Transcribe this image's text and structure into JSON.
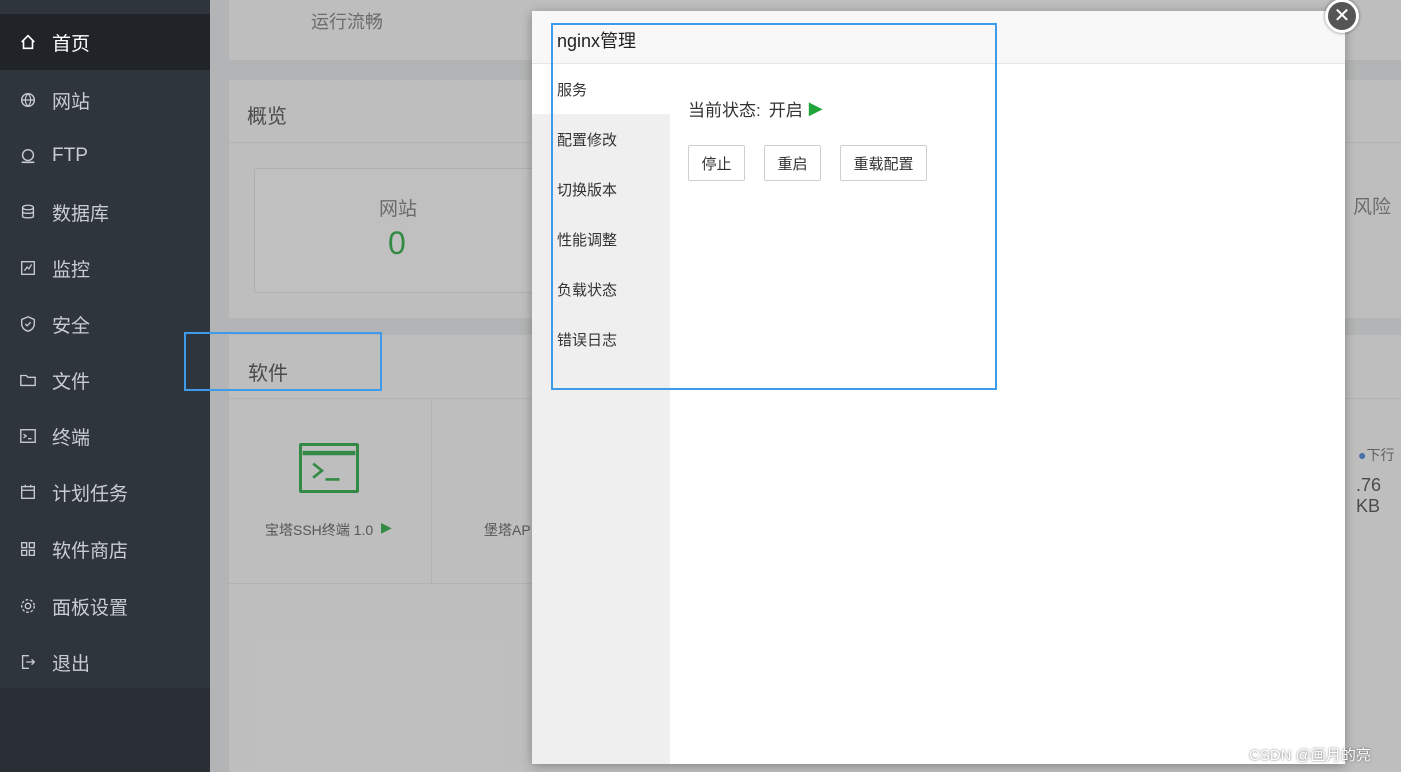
{
  "sidebar": {
    "items": [
      {
        "label": "首页",
        "icon": "home-icon",
        "active": true
      },
      {
        "label": "网站",
        "icon": "globe-icon"
      },
      {
        "label": "FTP",
        "icon": "ftp-icon"
      },
      {
        "label": "数据库",
        "icon": "database-icon"
      },
      {
        "label": "监控",
        "icon": "monitor-icon"
      },
      {
        "label": "安全",
        "icon": "shield-icon"
      },
      {
        "label": "文件",
        "icon": "folder-icon"
      },
      {
        "label": "终端",
        "icon": "terminal-icon"
      },
      {
        "label": "计划任务",
        "icon": "calendar-icon"
      },
      {
        "label": "软件商店",
        "icon": "apps-icon"
      },
      {
        "label": "面板设置",
        "icon": "gear-icon"
      },
      {
        "label": "退出",
        "icon": "logout-icon"
      }
    ]
  },
  "background": {
    "top_status": "运行流畅",
    "overview_title": "概览",
    "site_label": "网站",
    "site_count": "0",
    "risk_label": "风险",
    "software_title": "软件",
    "ssh_app": "宝塔SSH终端 1.0",
    "api_app": "堡塔AP",
    "download_label": "下行",
    "download_value": ".76 KB"
  },
  "dialog": {
    "title": "nginx管理",
    "nav": [
      "服务",
      "配置修改",
      "切换版本",
      "性能调整",
      "负载状态",
      "错误日志"
    ],
    "status_label": "当前状态:",
    "status_value": "开启",
    "buttons": {
      "stop": "停止",
      "restart": "重启",
      "reload": "重载配置"
    },
    "close_symbol": "✕"
  },
  "watermark": "CSDN @画月的亮",
  "colors": {
    "accent_green": "#20a53a",
    "highlight_blue": "#3d9be9",
    "sidebar_bg": "#2f353d"
  }
}
